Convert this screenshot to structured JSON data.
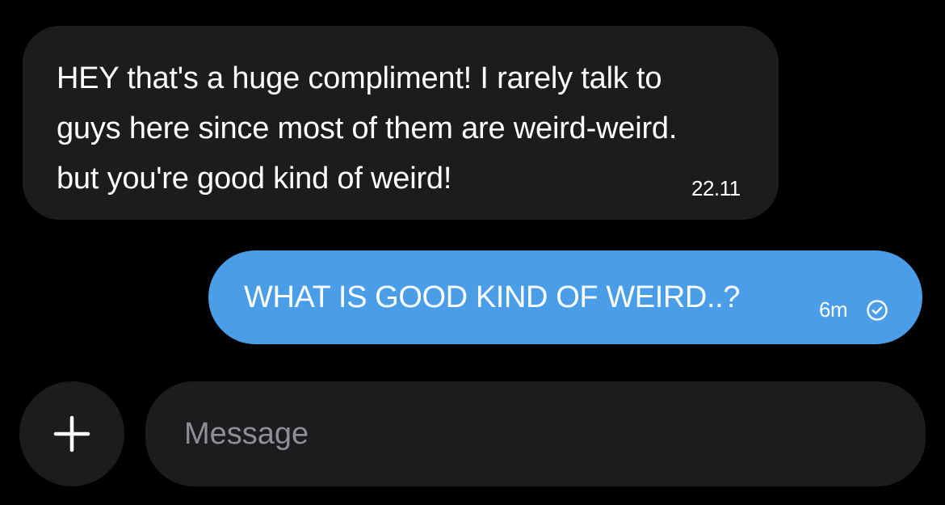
{
  "messages": [
    {
      "direction": "incoming",
      "text": "HEY that's a huge compliment! I rarely talk to guys here since most of them are weird-weird. but you're good kind of weird!",
      "time": "22.11"
    },
    {
      "direction": "outgoing",
      "text": "WHAT IS GOOD KIND OF WEIRD..?",
      "time": "6m",
      "status_icon": "check-circle-icon"
    }
  ],
  "composer": {
    "add_icon": "plus-icon",
    "placeholder": "Message",
    "value": ""
  },
  "colors": {
    "background": "#000000",
    "incoming_bubble": "#1c1c1e",
    "outgoing_bubble": "#4a9ee8",
    "placeholder_text": "#8e8e93"
  }
}
